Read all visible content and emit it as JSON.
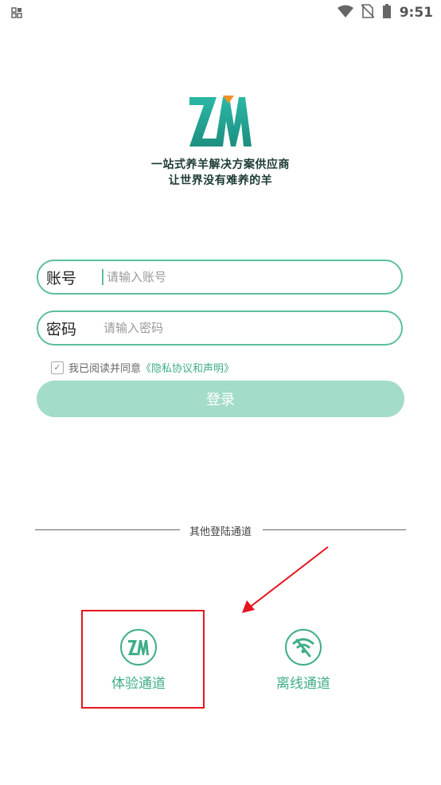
{
  "status_bar": {
    "time": "9:51",
    "icons": [
      "notification-grid-icon",
      "wifi-icon",
      "no-sim-icon",
      "battery-icon"
    ]
  },
  "slogan": {
    "line1": "一站式养羊解决方案供应商",
    "line2": "让世界没有难养的羊"
  },
  "form": {
    "account_label": "账号",
    "account_placeholder": "请输入账号",
    "password_label": "密码",
    "password_placeholder": "请输入密码",
    "agree_text": "我已阅读并同意",
    "agree_link": "《隐私协议和声明》",
    "agree_checked": true,
    "login_label": "登录"
  },
  "other_login": {
    "title": "其他登陆通道",
    "channels": [
      {
        "label": "体验通道",
        "icon": "zm-logo-icon"
      },
      {
        "label": "离线通道",
        "icon": "offline-signal-icon"
      }
    ]
  },
  "colors": {
    "accent": "#3fae86",
    "border": "#5bbf9e",
    "button": "#a3dcc8",
    "annotation": "#e5141e"
  }
}
